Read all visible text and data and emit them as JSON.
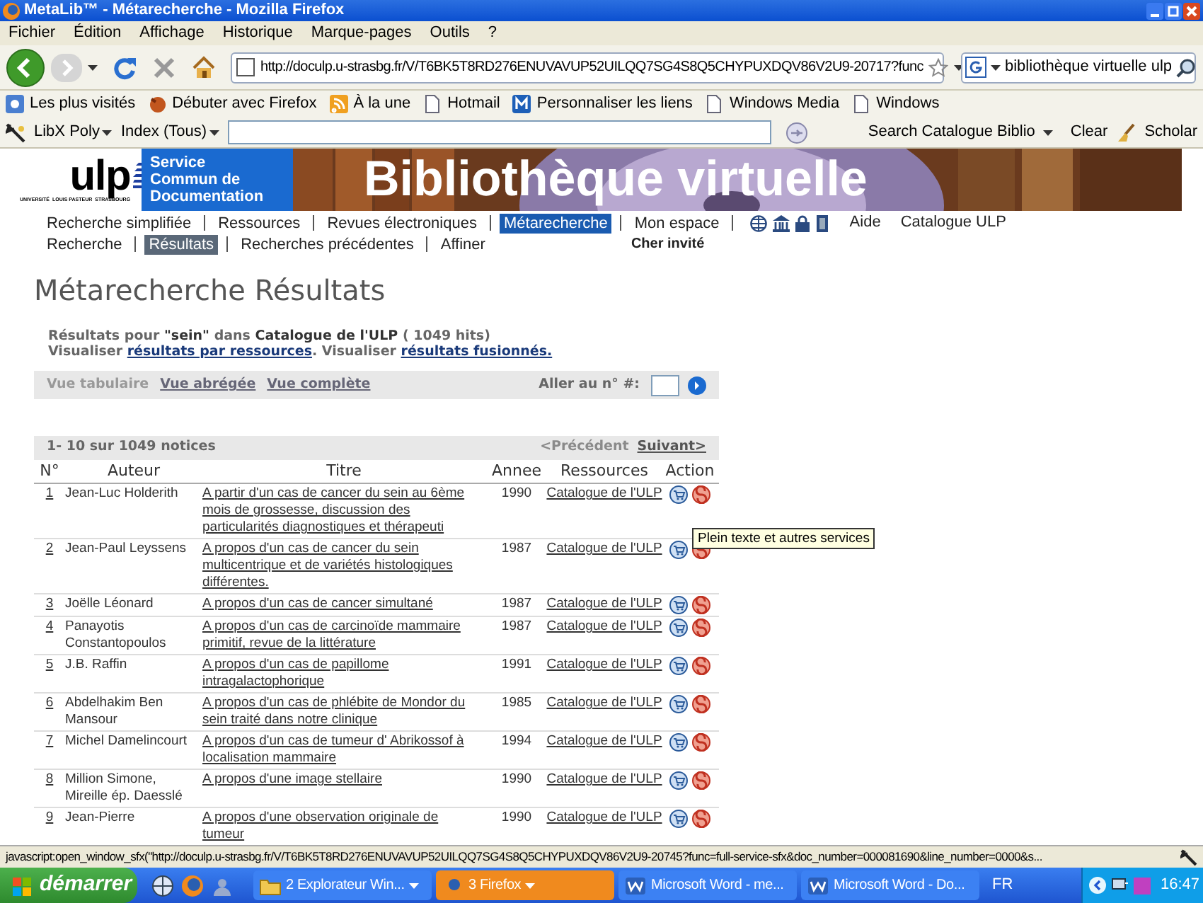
{
  "window": {
    "title": "MetaLib™ - Métarecherche - Mozilla Firefox"
  },
  "menu": [
    "Fichier",
    "Édition",
    "Affichage",
    "Historique",
    "Marque-pages",
    "Outils",
    "?"
  ],
  "address_bar": {
    "url": "http://doculp.u-strasbg.fr/V/T6BK5T8RD276ENUVAVUP52UILQQ7SG4S8Q5CHYPUXDQV86V2U9-20717?func"
  },
  "search_box": {
    "value": "bibliothèque virtuelle ulp"
  },
  "bookmarks": [
    {
      "label": "Les plus visités",
      "kind": "star"
    },
    {
      "label": "Débuter avec Firefox",
      "kind": "fox"
    },
    {
      "label": "À la une",
      "kind": "feed"
    },
    {
      "label": "Hotmail",
      "kind": "page"
    },
    {
      "label": "Personnaliser les liens",
      "kind": "m"
    },
    {
      "label": "Windows Media",
      "kind": "page"
    },
    {
      "label": "Windows",
      "kind": "page"
    }
  ],
  "libx_toolbar": {
    "menus": [
      "LibX Poly",
      "Index (Tous)"
    ],
    "search_button": "Search Catalogue Biblio",
    "clear": "Clear",
    "scholar": "Scholar"
  },
  "banner": {
    "logo": "ulp",
    "logo_captions": [
      "UNIVERSITÉ",
      "LOUIS PASTEUR",
      "STRASBOURG"
    ],
    "service_lines": [
      "Service",
      "Commun de",
      "Documentation"
    ],
    "title": "Bibliothèque virtuelle"
  },
  "main_nav": [
    {
      "label": "Recherche simplifiée",
      "selected": false
    },
    {
      "label": "Ressources",
      "selected": false
    },
    {
      "label": "Revues électroniques",
      "selected": false
    },
    {
      "label": "Métarecherche",
      "selected": true
    },
    {
      "label": "Mon espace",
      "selected": false
    }
  ],
  "nav_links": [
    "Aide",
    "Catalogue ULP"
  ],
  "sub_nav": [
    {
      "label": "Recherche",
      "selected": false
    },
    {
      "label": "Résultats",
      "selected": true
    },
    {
      "label": "Recherches précédentes",
      "selected": false
    },
    {
      "label": "Affiner",
      "selected": false
    }
  ],
  "user": "Cher invité",
  "heading": "Métarecherche Résultats",
  "summary": "Résultats pour **\"sein\"** dans **Catalogue de l'ULP** ( 1049 hits)",
  "view_links_line": [
    {
      "kind": "text",
      "text": "Visualiser "
    },
    {
      "kind": "link",
      "text": "résultats par ressources"
    },
    {
      "kind": "text",
      "text": ". Visualiser "
    },
    {
      "kind": "link",
      "text": "résultats fusionnés."
    }
  ],
  "view_tabs": [
    {
      "label": "Vue tabulaire",
      "selected": true
    },
    {
      "label": "Vue abrégée",
      "selected": false
    },
    {
      "label": "Vue complète",
      "selected": false
    }
  ],
  "goto_label": "Aller au n° #:",
  "pagination": {
    "range": "**1- 10** sur **1049** notices",
    "links": [
      {
        "label": "<Précédent",
        "disabled": true
      },
      {
        "label": "Suivant>",
        "disabled": false
      }
    ]
  },
  "table": {
    "columns": [
      "N°",
      "Auteur",
      "Titre",
      "Annee",
      "Ressources",
      "Action"
    ],
    "rows": [
      {
        "no": "1",
        "author": "Jean-Luc Holderith",
        "title": "A partir d'un cas de cancer du sein au 6ème mois de grossesse, discussion des particularités diagnostiques et thérapeuti",
        "year": "1990",
        "resource": "Catalogue de l'ULP"
      },
      {
        "no": "2",
        "author": "Jean-Paul Leyssens",
        "title": "A propos d'un cas de cancer du sein multicentrique et de variétés histologiques différentes.",
        "year": "1987",
        "resource": "Catalogue de l'ULP"
      },
      {
        "no": "3",
        "author": "Joëlle Léonard",
        "title": "A propos d'un cas de cancer simultané",
        "year": "1987",
        "resource": "Catalogue de l'ULP"
      },
      {
        "no": "4",
        "author": "Panayotis Constantopoulos",
        "title": "A propos d'un cas de carcinoïde mammaire primitif, revue de la littérature",
        "year": "1987",
        "resource": "Catalogue de l'ULP"
      },
      {
        "no": "5",
        "author": "J.B. Raffin",
        "title": "A propos d'un cas de papillome intragalactophorique",
        "year": "1991",
        "resource": "Catalogue de l'ULP"
      },
      {
        "no": "6",
        "author": "Abdelhakim Ben Mansour",
        "title": "A propos d'un cas de phlébite de Mondor du sein traité dans notre clinique",
        "year": "1985",
        "resource": "Catalogue de l'ULP"
      },
      {
        "no": "7",
        "author": "Michel Damelincourt",
        "title": "A propos d'un cas de tumeur d' Abrikossof à localisation mammaire",
        "year": "1994",
        "resource": "Catalogue de l'ULP"
      },
      {
        "no": "8",
        "author": "Million Simone, Mireille ép. Daesslé",
        "title": "A propos d'une image stellaire",
        "year": "1990",
        "resource": "Catalogue de l'ULP"
      },
      {
        "no": "9",
        "author": "Jean-Pierre",
        "title": "A propos d'une observation originale de tumeur",
        "year": "1990",
        "resource": "Catalogue de l'ULP"
      }
    ]
  },
  "tooltip": "Plein texte et autres services",
  "status_bar": "javascript:open_window_sfx(\"http://doculp.u-strasbg.fr/V/T6BK5T8RD276ENUVAVUP52UILQQ7SG4S8Q5CHYPUXDQV86V2U9-20745?func=full-service-sfx&doc_number=000081690&line_number=0000&s...",
  "taskbar": {
    "start": "démarrer",
    "tasks": [
      {
        "label": "2 Explorateur Win...",
        "kind": "folder",
        "selected": false
      },
      {
        "label": "3 Firefox",
        "kind": "firefox",
        "selected": true
      },
      {
        "label": "Microsoft Word - me...",
        "kind": "word",
        "selected": false
      },
      {
        "label": "Microsoft Word - Do...",
        "kind": "word",
        "selected": false
      }
    ],
    "language": "FR",
    "clock": "16:47"
  }
}
